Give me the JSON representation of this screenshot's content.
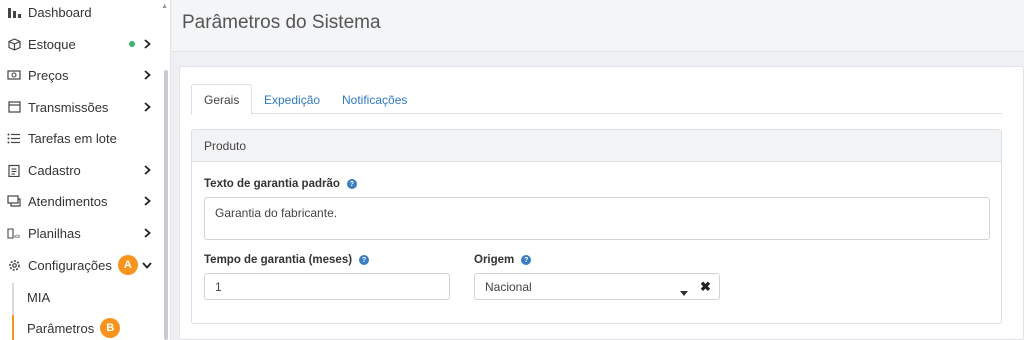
{
  "sidebar": {
    "items": [
      {
        "label": "Dashboard",
        "icon": "bar-chart-icon"
      },
      {
        "label": "Estoque",
        "icon": "box-icon",
        "status_color": "#3bb36f"
      },
      {
        "label": "Preços",
        "icon": "price-tag-icon"
      },
      {
        "label": "Transmissões",
        "icon": "calendar-icon"
      },
      {
        "label": "Tarefas em lote",
        "icon": "list-icon"
      },
      {
        "label": "Cadastro",
        "icon": "clipboard-icon"
      },
      {
        "label": "Atendimentos",
        "icon": "chat-icon"
      },
      {
        "label": "Planilhas",
        "icon": "spreadsheet-icon"
      },
      {
        "label": "Configurações",
        "icon": "gear-icon",
        "badge": "A",
        "expanded": true
      }
    ],
    "subitems": [
      {
        "label": "MIA"
      },
      {
        "label": "Parâmetros",
        "badge": "B",
        "active": true
      }
    ],
    "accent_color": "#f7941d"
  },
  "header": {
    "title": "Parâmetros do Sistema"
  },
  "tabs": [
    {
      "label": "Gerais",
      "active": true
    },
    {
      "label": "Expedição"
    },
    {
      "label": "Notificações"
    }
  ],
  "panel": {
    "title": "Produto",
    "warranty_text": {
      "label": "Texto de garantia padrão",
      "value": "Garantia do fabricante."
    },
    "warranty_time": {
      "label": "Tempo de garantia (meses)",
      "value": "1"
    },
    "origin": {
      "label": "Origem",
      "value": "Nacional",
      "clear_label": "✖"
    }
  }
}
